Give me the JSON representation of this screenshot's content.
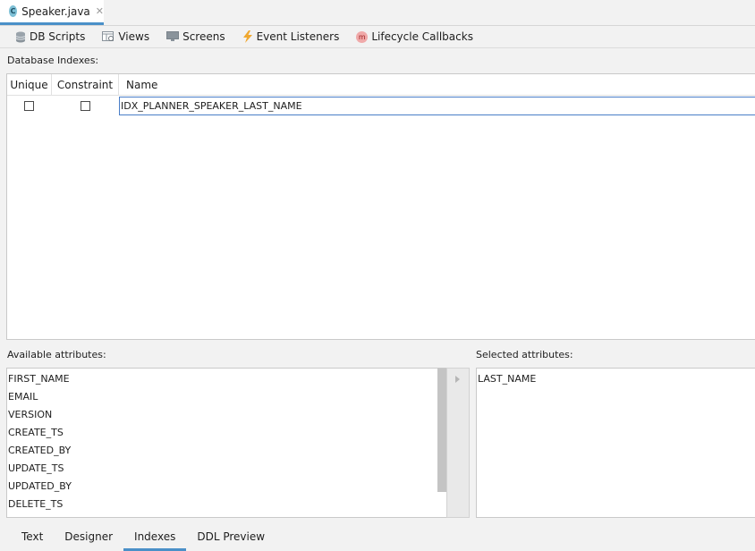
{
  "editor_tab": {
    "label": "Speaker.java",
    "icon": "java-class-icon"
  },
  "toolbar": {
    "items": [
      {
        "label": "DB Scripts",
        "icon": "database-icon"
      },
      {
        "label": "Views",
        "icon": "views-icon"
      },
      {
        "label": "Screens",
        "icon": "screen-icon"
      },
      {
        "label": "Event Listeners",
        "icon": "lightning-icon"
      },
      {
        "label": "Lifecycle Callbacks",
        "icon": "method-icon"
      }
    ]
  },
  "indexes": {
    "section_label": "Database Indexes:",
    "columns": [
      "Unique",
      "Constraint",
      "Name"
    ],
    "rows": [
      {
        "unique": false,
        "constraint": false,
        "name": "IDX_PLANNER_SPEAKER_LAST_NAME"
      }
    ]
  },
  "available": {
    "label": "Available attributes:",
    "items": [
      "FIRST_NAME",
      "EMAIL",
      "VERSION",
      "CREATE_TS",
      "CREATED_BY",
      "UPDATE_TS",
      "UPDATED_BY",
      "DELETE_TS"
    ]
  },
  "selected": {
    "label": "Selected attributes:",
    "items": [
      "LAST_NAME"
    ]
  },
  "bottom_tabs": {
    "items": [
      "Text",
      "Designer",
      "Indexes",
      "DDL Preview"
    ],
    "active": "Indexes"
  },
  "colors": {
    "accent": "#4a90c8",
    "selection_border": "#4a7ec8"
  }
}
